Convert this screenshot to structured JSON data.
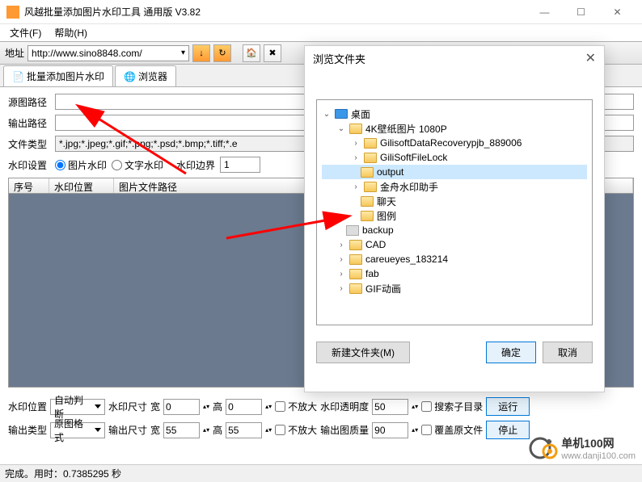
{
  "window": {
    "title": "风越批量添加图片水印工具 通用版 V3.82"
  },
  "menu": {
    "file": "文件(F)",
    "help": "帮助(H)"
  },
  "toolbar": {
    "addr_label": "地址",
    "url": "http://www.sino8848.com/"
  },
  "tabs": {
    "tab1": "批量添加图片水印",
    "tab2": "浏览器"
  },
  "fields": {
    "srcpath_label": "源图路径",
    "outpath_label": "输出路径",
    "filetype_label": "文件类型",
    "filetype_value": "*.jpg;*.jpeg;*.gif;*.png;*.psd;*.bmp;*.tiff;*.e",
    "wm_setting_label": "水印设置",
    "wm_image": "图片水印",
    "wm_text": "文字水印",
    "wm_border_label": "水印边界",
    "wm_border_value": "1"
  },
  "list": {
    "col_seq": "序号",
    "col_pos": "水印位置",
    "col_path": "图片文件路径"
  },
  "bottom": {
    "wm_pos_label": "水印位置",
    "wm_pos_value": "自动判断",
    "wm_size_label": "水印尺寸",
    "width_label": "宽",
    "height_label": "高",
    "out_type_label": "输出类型",
    "out_type_value": "原图格式",
    "out_size_label": "输出尺寸",
    "w0": "0",
    "h0": "0",
    "w55": "55",
    "h55": "55",
    "no_enlarge": "不放大",
    "wm_opacity_label": "水印透明度",
    "wm_opacity_value": "50",
    "out_quality_label": "输出图质量",
    "out_quality_value": "90",
    "search_sub": "搜索子目录",
    "overwrite": "覆盖原文件",
    "run": "运行",
    "stop": "停止"
  },
  "status": {
    "text": "完成。用时：0.7385295 秒"
  },
  "dialog": {
    "title": "浏览文件夹",
    "newfolder": "新建文件夹(M)",
    "ok": "确定",
    "cancel": "取消",
    "tree": {
      "desktop": "桌面",
      "n1": "4K壁纸图片 1080P",
      "n2": "GilisoftDataRecoverypjb_889006",
      "n3": "GiliSoftFileLock",
      "n4": "output",
      "n5": "金舟水印助手",
      "n6": "聊天",
      "n7": "图例",
      "n8": "backup",
      "n9": "CAD",
      "n10": "careueyes_183214",
      "n11": "fab",
      "n12": "GIF动画"
    }
  },
  "watermark": {
    "brand": "单机100网",
    "url": "www.danji100.com"
  }
}
